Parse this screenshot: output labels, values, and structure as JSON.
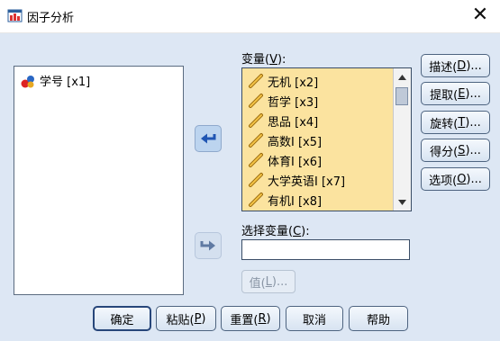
{
  "window": {
    "title": "因子分析"
  },
  "source_list": {
    "items": [
      {
        "label": "学号 [x1]",
        "icon": "nominal-variable-icon"
      }
    ]
  },
  "variables": {
    "label_prefix": "变量(",
    "label_key": "V",
    "label_suffix": "):",
    "items": [
      {
        "label": "无机 [x2]",
        "icon": "scale-ruler-icon"
      },
      {
        "label": "哲学 [x3]",
        "icon": "scale-ruler-icon"
      },
      {
        "label": "思品 [x4]",
        "icon": "scale-ruler-icon"
      },
      {
        "label": "高数I [x5]",
        "icon": "scale-ruler-icon"
      },
      {
        "label": "体育I [x6]",
        "icon": "scale-ruler-icon"
      },
      {
        "label": "大学英语I [x7]",
        "icon": "scale-ruler-icon"
      },
      {
        "label": "有机I [x8]",
        "icon": "scale-ruler-icon"
      }
    ]
  },
  "selection": {
    "label_prefix": "选择变量(",
    "label_key": "C",
    "label_suffix": "):",
    "value": "",
    "value_button": {
      "prefix": "值(",
      "key": "L",
      "suffix": ")..."
    }
  },
  "side_buttons": [
    {
      "prefix": "描述(",
      "key": "D",
      "suffix": ")..."
    },
    {
      "prefix": "提取(",
      "key": "E",
      "suffix": ")..."
    },
    {
      "prefix": "旋转(",
      "key": "T",
      "suffix": ")..."
    },
    {
      "prefix": "得分(",
      "key": "S",
      "suffix": ")..."
    },
    {
      "prefix": "选项(",
      "key": "O",
      "suffix": ")..."
    }
  ],
  "bottom_buttons": {
    "ok": {
      "label": "确定"
    },
    "paste": {
      "prefix": "粘贴(",
      "key": "P",
      "suffix": ")"
    },
    "reset": {
      "prefix": "重置(",
      "key": "R",
      "suffix": ")"
    },
    "cancel": {
      "label": "取消"
    },
    "help": {
      "label": "帮助"
    }
  },
  "colors": {
    "client_bg": "#dde7f4",
    "selected_bg": "#fbe39f",
    "button_border": "#4e6480"
  }
}
